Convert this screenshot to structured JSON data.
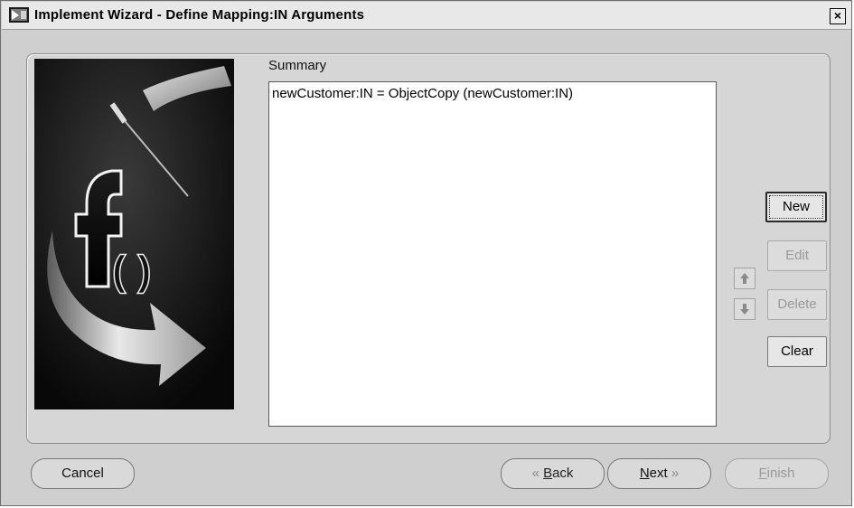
{
  "window": {
    "title": "Implement Wizard - Define Mapping:IN Arguments",
    "close_glyph": "×"
  },
  "summary": {
    "label": "Summary",
    "items": [
      "newCustomer:IN = ObjectCopy (newCustomer:IN)"
    ]
  },
  "side_buttons": {
    "new": "New",
    "edit": "Edit",
    "delete": "Delete",
    "clear": "Clear"
  },
  "reorder": {
    "up_icon": "arrow-up-icon",
    "down_icon": "arrow-down-icon"
  },
  "footer": {
    "cancel": "Cancel",
    "back_chevron": "«",
    "back_mnemonic": "B",
    "back_rest": "ack",
    "next_mnemonic": "N",
    "next_rest": "ext",
    "next_chevron": "»",
    "finish_mnemonic": "F",
    "finish_rest": "inish"
  },
  "colors": {
    "window_bg": "#cfcfcf",
    "panel_bg": "#d6d6d6",
    "art_bg": "#0d0d0d",
    "disabled_text": "#9a9a9a"
  }
}
